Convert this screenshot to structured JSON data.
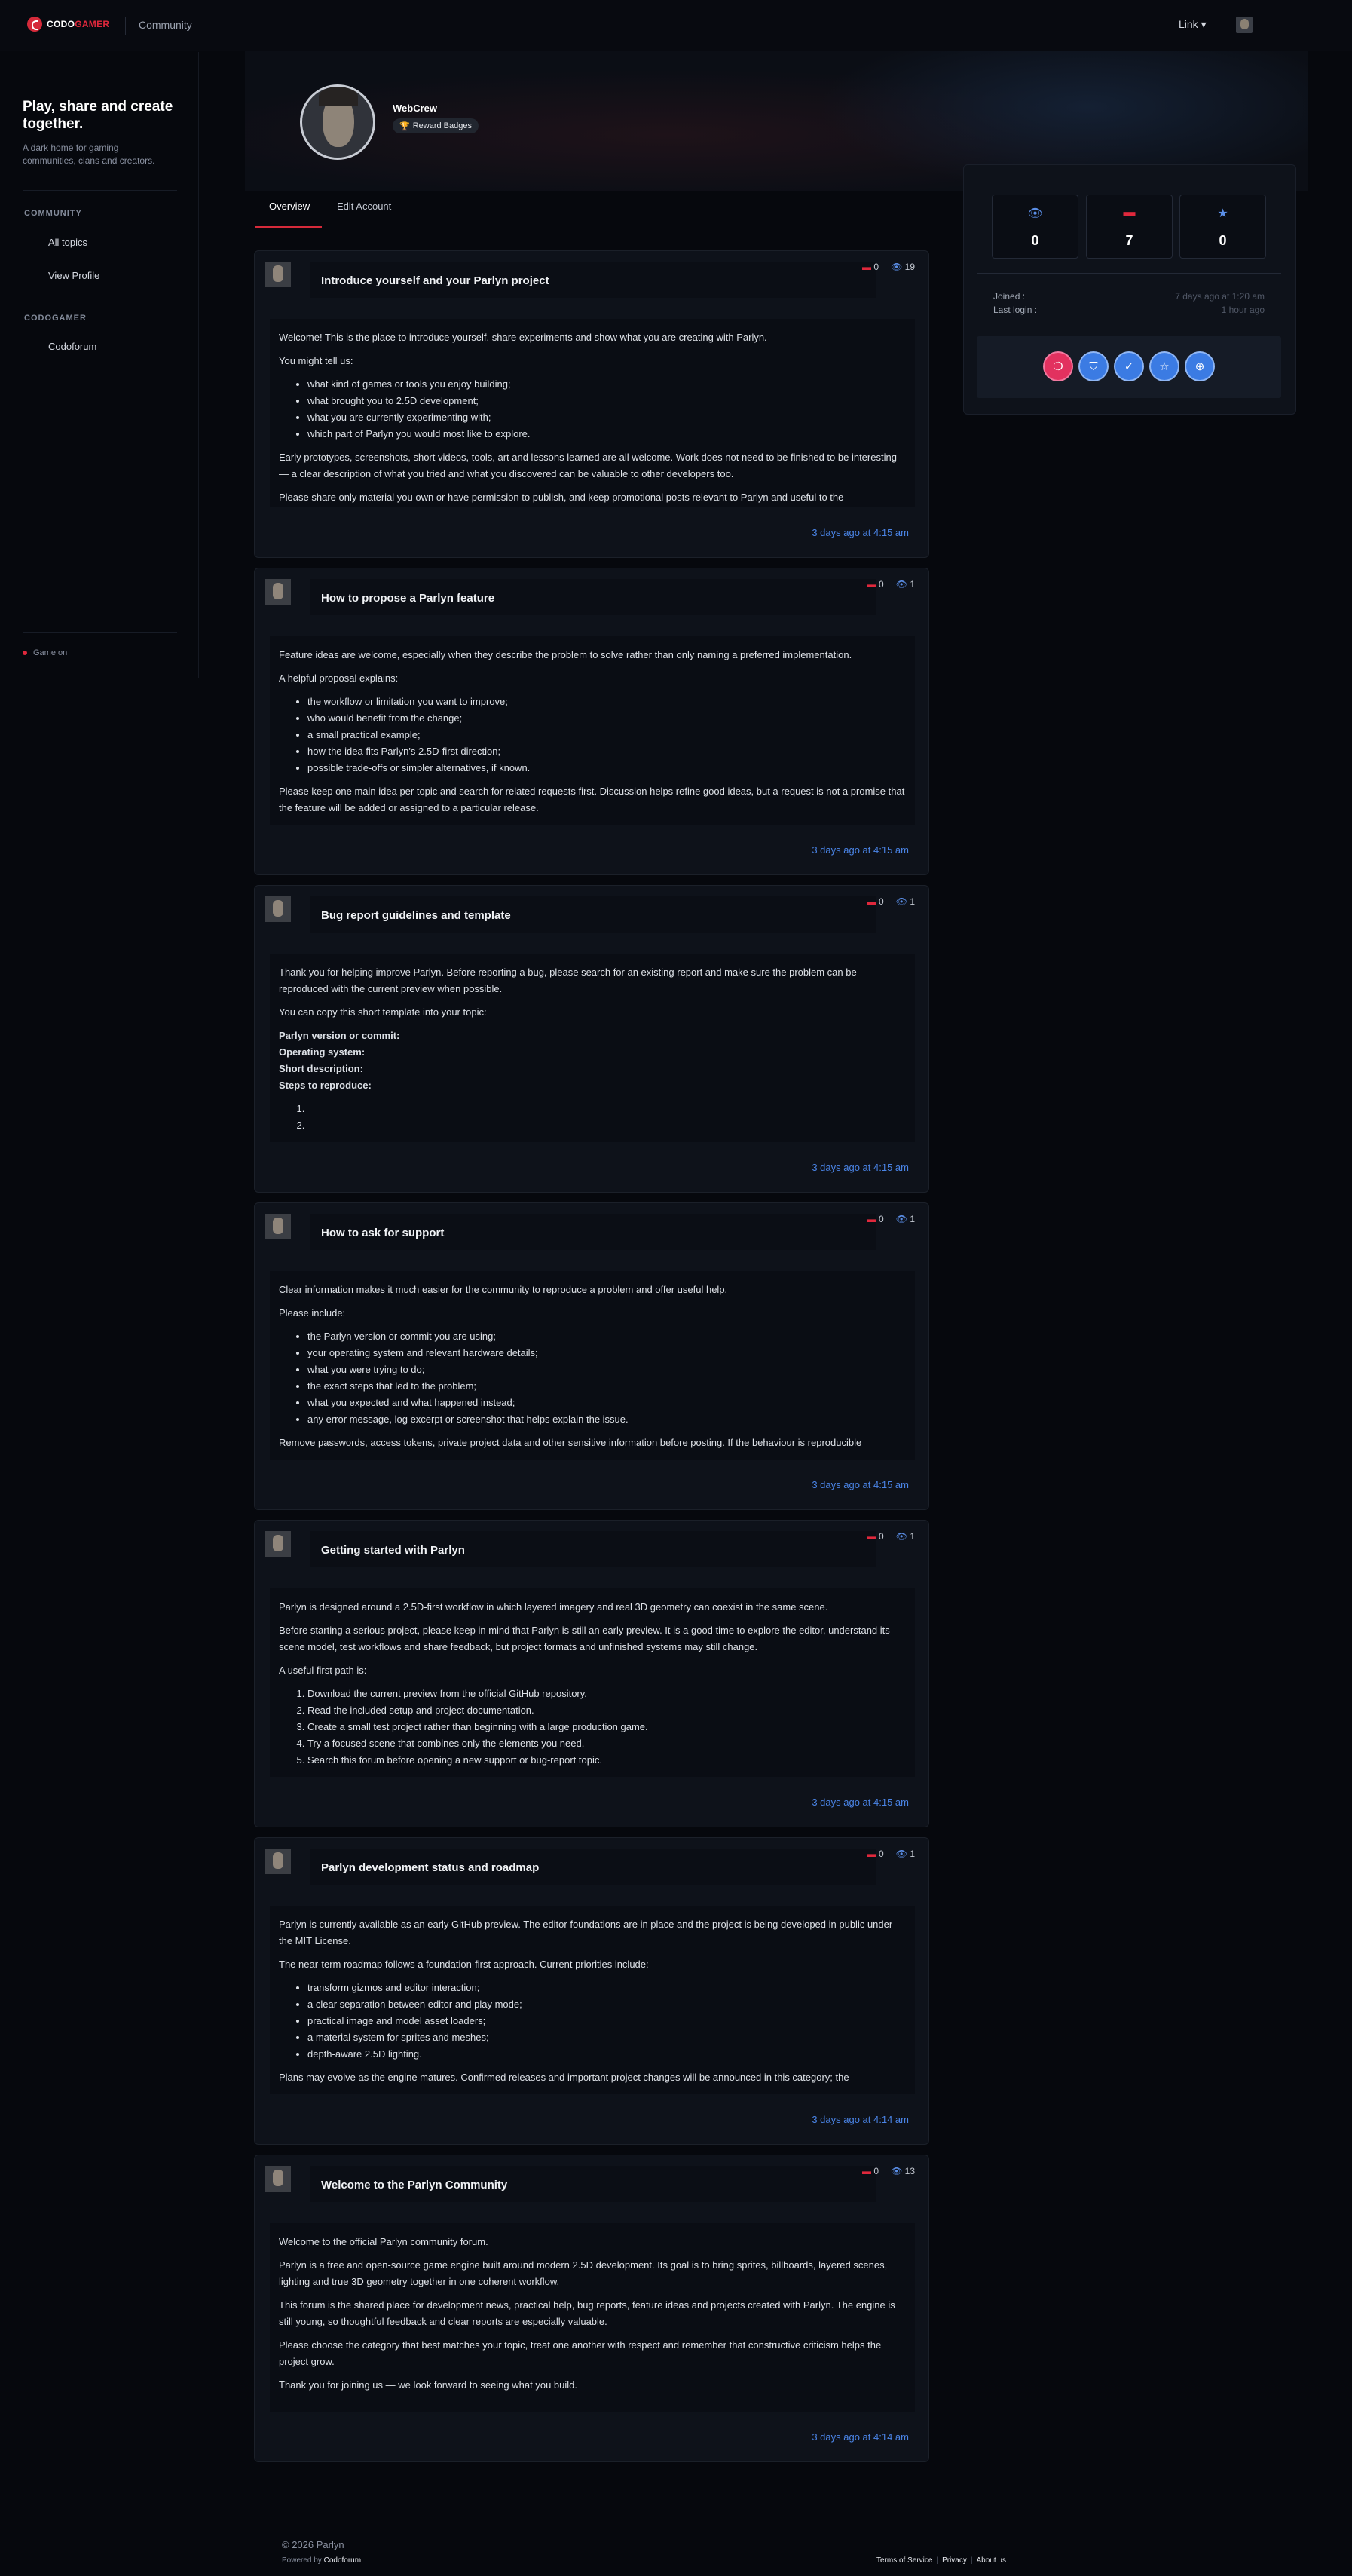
{
  "header": {
    "logo_brand": "CODO",
    "logo_brand_accent": "GAMER",
    "community_label": "Community",
    "link_label": "Link ▾"
  },
  "sidebar": {
    "title": "Play, share and create together.",
    "subtitle": "A dark home for gaming communities, clans and creators.",
    "sections": [
      {
        "heading": "COMMUNITY",
        "items": [
          "All topics",
          "View Profile"
        ]
      },
      {
        "heading": "CODOGAMER",
        "items": [
          "Codoforum"
        ]
      }
    ],
    "status": "Game on"
  },
  "profile": {
    "name": "WebCrew",
    "badge_label": "Reward Badges",
    "tabs": [
      "Overview",
      "Edit Account"
    ],
    "stats": {
      "views": "0",
      "posts": "7",
      "reputation": "0"
    },
    "joined_label": "Joined :",
    "joined_value": "7 days ago at 1:20 am",
    "last_login_label": "Last login :",
    "last_login_value": "1 hour ago",
    "reward_badges": [
      "flame-badge-icon",
      "shield-badge-icon",
      "check-badge-icon",
      "star-badge-icon",
      "gamepad-badge-icon"
    ],
    "accent_color": "#d52a3a",
    "link_color": "#4a84e6"
  },
  "topics": [
    {
      "title": "Introduce yourself and your Parlyn project",
      "replies": "0",
      "views": "19",
      "date": "3 days ago at 4:15 am",
      "blocks": [
        {
          "p": "Welcome! This is the place to introduce yourself, share experiments and show what you are creating with Parlyn."
        },
        {
          "p": "You might tell us:"
        },
        {
          "ul": [
            "what kind of games or tools you enjoy building;",
            "what brought you to 2.5D development;",
            "what you are currently experimenting with;",
            "which part of Parlyn you would most like to explore."
          ]
        },
        {
          "p": "Early prototypes, screenshots, short videos, tools, art and lessons learned are all welcome. Work does not need to be finished to be interesting — a clear description of what you tried and what you discovered can be valuable to other developers too."
        },
        {
          "p": "Please share only material you own or have permission to publish, and keep promotional posts relevant to Parlyn and useful to the"
        }
      ]
    },
    {
      "title": "How to propose a Parlyn feature",
      "replies": "0",
      "views": "1",
      "date": "3 days ago at 4:15 am",
      "blocks": [
        {
          "p": "Feature ideas are welcome, especially when they describe the problem to solve rather than only naming a preferred implementation."
        },
        {
          "p": "A helpful proposal explains:"
        },
        {
          "ul": [
            "the workflow or limitation you want to improve;",
            "who would benefit from the change;",
            "a small practical example;",
            "how the idea fits Parlyn's 2.5D-first direction;",
            "possible trade-offs or simpler alternatives, if known."
          ]
        },
        {
          "p": "Please keep one main idea per topic and search for related requests first. Discussion helps refine good ideas, but a request is not a promise that the feature will be added or assigned to a particular release."
        }
      ]
    },
    {
      "title": "Bug report guidelines and template",
      "replies": "0",
      "views": "1",
      "date": "3 days ago at 4:15 am",
      "blocks": [
        {
          "p": "Thank you for helping improve Parlyn. Before reporting a bug, please search for an existing report and make sure the problem can be reproduced with the current preview when possible."
        },
        {
          "p": "You can copy this short template into your topic:"
        },
        {
          "bold": [
            "Parlyn version or commit:",
            "Operating system:",
            "Short description:",
            "Steps to reproduce:"
          ]
        },
        {
          "ol": [
            "",
            ""
          ]
        }
      ]
    },
    {
      "title": "How to ask for support",
      "replies": "0",
      "views": "1",
      "date": "3 days ago at 4:15 am",
      "blocks": [
        {
          "p": "Clear information makes it much easier for the community to reproduce a problem and offer useful help."
        },
        {
          "p": "Please include:"
        },
        {
          "ul": [
            "the Parlyn version or commit you are using;",
            "your operating system and relevant hardware details;",
            "what you were trying to do;",
            "the exact steps that led to the problem;",
            "what you expected and what happened instead;",
            "any error message, log excerpt or screenshot that helps explain the issue."
          ]
        },
        {
          "p": "Remove passwords, access tokens, private project data and other sensitive information before posting. If the behaviour is reproducible"
        }
      ]
    },
    {
      "title": "Getting started with Parlyn",
      "replies": "0",
      "views": "1",
      "date": "3 days ago at 4:15 am",
      "blocks": [
        {
          "p": "Parlyn is designed around a 2.5D-first workflow in which layered imagery and real 3D geometry can coexist in the same scene."
        },
        {
          "p": "Before starting a serious project, please keep in mind that Parlyn is still an early preview. It is a good time to explore the editor, understand its scene model, test workflows and share feedback, but project formats and unfinished systems may still change."
        },
        {
          "p": "A useful first path is:"
        },
        {
          "ol": [
            "Download the current preview from the official GitHub repository.",
            "Read the included setup and project documentation.",
            "Create a small test project rather than beginning with a large production game.",
            "Try a focused scene that combines only the elements you need.",
            "Search this forum before opening a new support or bug-report topic."
          ]
        }
      ]
    },
    {
      "title": "Parlyn development status and roadmap",
      "replies": "0",
      "views": "1",
      "date": "3 days ago at 4:14 am",
      "blocks": [
        {
          "p": "Parlyn is currently available as an early GitHub preview. The editor foundations are in place and the project is being developed in public under the MIT License."
        },
        {
          "p": "The near-term roadmap follows a foundation-first approach. Current priorities include:"
        },
        {
          "ul": [
            "transform gizmos and editor interaction;",
            "a clear separation between editor and play mode;",
            "practical image and model asset loaders;",
            "a material system for sprites and meshes;",
            "depth-aware 2.5D lighting."
          ]
        },
        {
          "p": "Plans may evolve as the engine matures. Confirmed releases and important project changes will be announced in this category; the"
        }
      ]
    },
    {
      "title": "Welcome to the Parlyn Community",
      "replies": "0",
      "views": "13",
      "date": "3 days ago at 4:14 am",
      "blocks": [
        {
          "p": "Welcome to the official Parlyn community forum."
        },
        {
          "p": "Parlyn is a free and open-source game engine built around modern 2.5D development. Its goal is to bring sprites, billboards, layered scenes, lighting and true 3D geometry together in one coherent workflow."
        },
        {
          "p": "This forum is the shared place for development news, practical help, bug reports, feature ideas and projects created with Parlyn. The engine is still young, so thoughtful feedback and clear reports are especially valuable."
        },
        {
          "p": "Please choose the category that best matches your topic, treat one another with respect and remember that constructive criticism helps the project grow."
        },
        {
          "p": "Thank you for joining us — we look forward to seeing what you build."
        }
      ]
    }
  ],
  "footer": {
    "copyright": "© 2026 Parlyn",
    "powered_prefix": "Powered by",
    "powered_name": "Codoforum",
    "links": [
      "Terms of Service",
      "Privacy",
      "About us"
    ]
  }
}
